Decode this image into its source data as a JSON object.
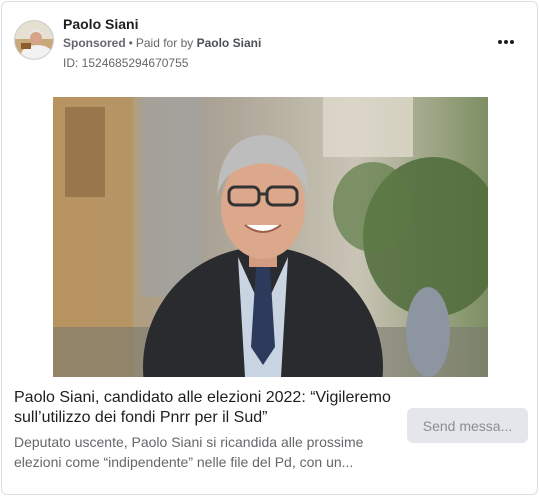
{
  "ad": {
    "page_name": "Paolo Siani",
    "sponsored_label": "Sponsored",
    "separator": "•",
    "paid_for_prefix": "Paid for by",
    "paid_for_name": "Paolo Siani",
    "ad_id": "ID: 1524685294670755",
    "more_icon": "more-horizontal-icon"
  },
  "media": {
    "image_subject": "photo",
    "colors": {
      "sky": "#d9d6cc",
      "building_left": "#b89a6a",
      "foliage": "#4f6b3a",
      "jacket": "#2a2b2e",
      "hair": "#bdbdbd",
      "skin": "#d9a88a"
    }
  },
  "link": {
    "headline": "Paolo Siani, candidato alle elezioni 2022: “Vigileremo sull’utilizzo dei fondi Pnrr per il Sud”",
    "description": "Deputato uscente, Paolo Siani si ricandida alle prossime elezioni come “indipendente” nelle file del Pd, con un...",
    "cta_label": "Send messa..."
  }
}
